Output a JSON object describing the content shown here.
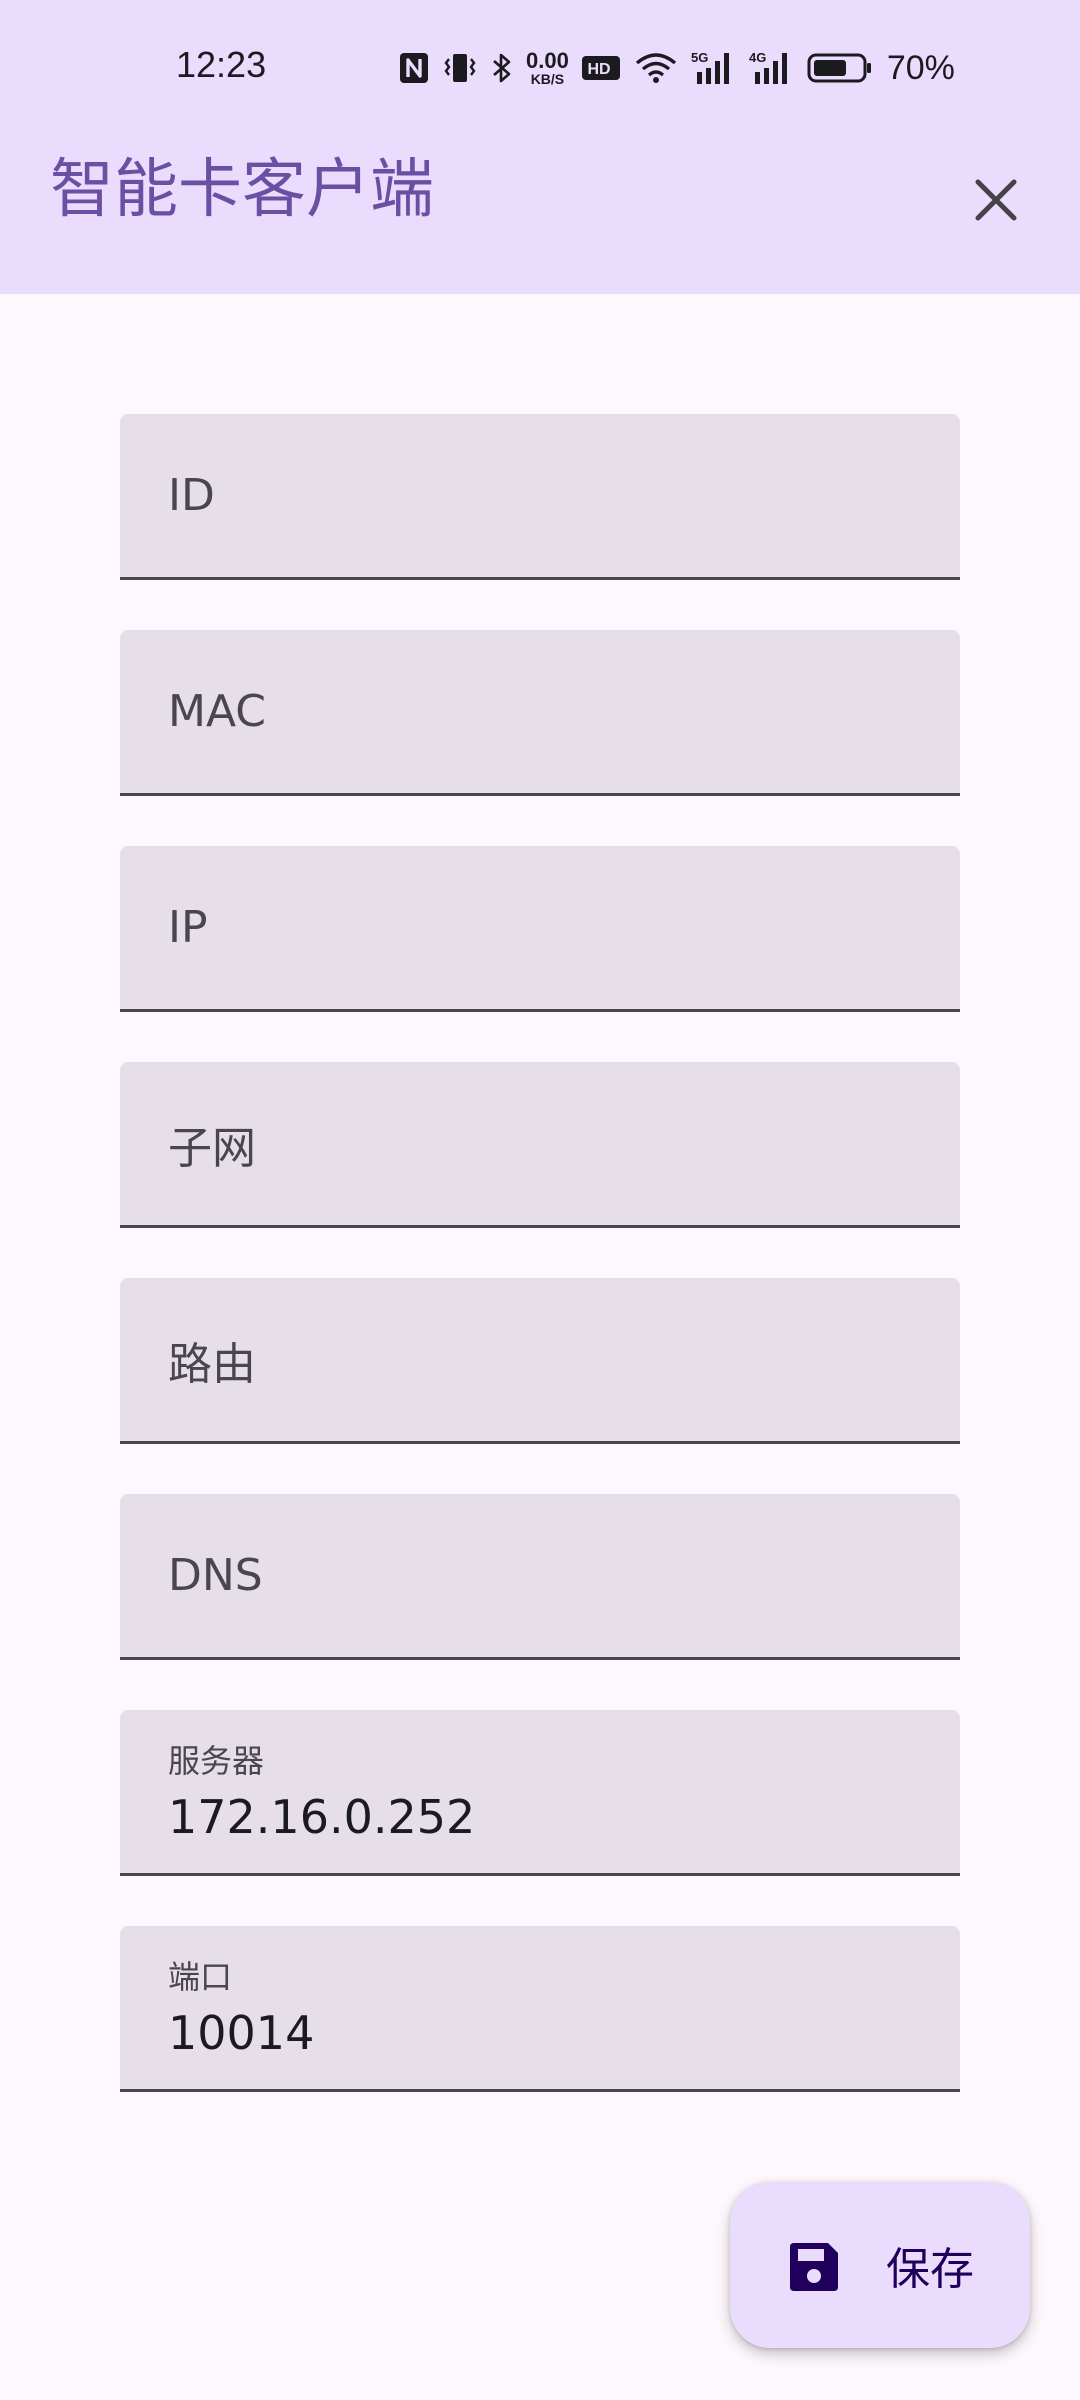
{
  "status_bar": {
    "time": "12:23",
    "net_speed_value": "0.00",
    "net_speed_unit": "KB/S",
    "hd_badge": "HD",
    "signal1": "5G",
    "signal2": "4G",
    "battery_percent": "70%",
    "battery_level": 0.7,
    "icons": [
      "nfc-icon",
      "vibrate-icon",
      "bluetooth-icon",
      "hd-voice-icon",
      "wifi-icon",
      "signal-5g-icon",
      "signal-4g-icon",
      "battery-icon"
    ]
  },
  "app_bar": {
    "title": "智能卡客户端",
    "close_icon": "close-icon"
  },
  "form": {
    "fields": [
      {
        "label": "ID",
        "value": ""
      },
      {
        "label": "MAC",
        "value": ""
      },
      {
        "label": "IP",
        "value": ""
      },
      {
        "label": "子网",
        "value": ""
      },
      {
        "label": "路由",
        "value": ""
      },
      {
        "label": "DNS",
        "value": ""
      },
      {
        "label": "服务器",
        "value": "172.16.0.252"
      },
      {
        "label": "端口",
        "value": "10014"
      }
    ]
  },
  "fab": {
    "label": "保存",
    "icon": "save-icon"
  },
  "colors": {
    "app_bar_bg": "#eadcfd",
    "title": "#6a4fa3",
    "field_bg": "#e6dfea",
    "page_bg": "#fdf8fd",
    "fab_bg": "#eadcfd",
    "fab_fg": "#21005d"
  }
}
